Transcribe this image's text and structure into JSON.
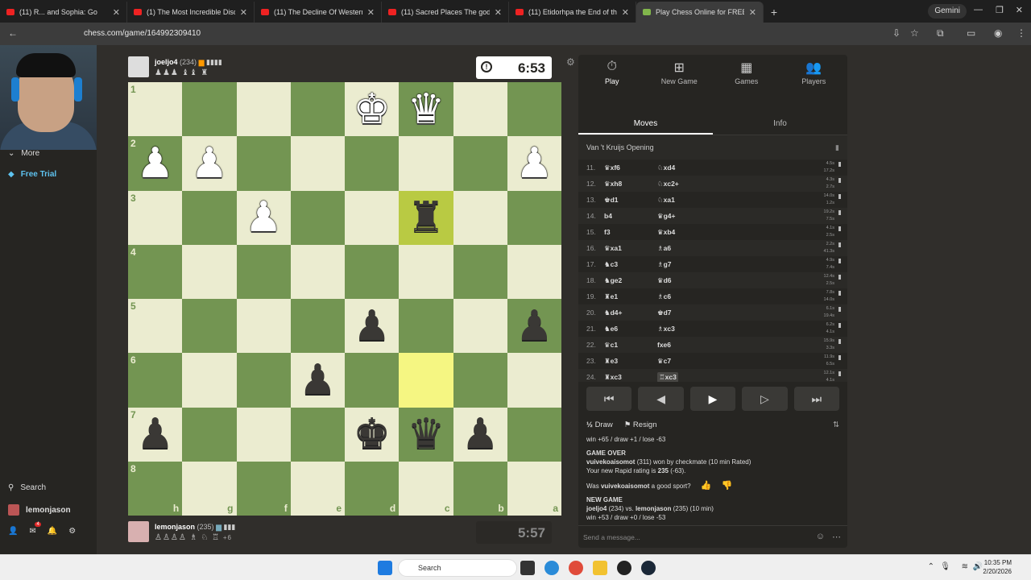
{
  "browser": {
    "tabs": [
      {
        "title": "(11) R... and Sophia: Go",
        "active": false
      },
      {
        "title": "(1) The Most Incredible Disco",
        "active": false
      },
      {
        "title": "(11) The Decline Of Western Ci",
        "active": false
      },
      {
        "title": "(11) Sacred Places The gods Sa",
        "active": false
      },
      {
        "title": "(11) Etidorhpa the End of the E",
        "active": false
      },
      {
        "title": "Play Chess Online for FREE",
        "active": true
      }
    ],
    "new_tab": "+",
    "gemini": "Gemini",
    "url": "chess.com/game/164992309410"
  },
  "sidebar": {
    "more": "More",
    "free_trial": "Free Trial",
    "search": "Search",
    "username": "lemonjason",
    "notif_count": "4"
  },
  "top_player": {
    "name": "joeljo4",
    "rating": "(234)",
    "captured": "♟♟♟ ♝♝ ♜",
    "clock": "6:53"
  },
  "bottom_player": {
    "name": "lemonjason",
    "rating": "(235)",
    "captured": "♙♙♙♙ ♗ ♘ ♖",
    "advantage": "+6",
    "clock": "5:57"
  },
  "board": {
    "ranks": [
      "1",
      "2",
      "3",
      "4",
      "5",
      "6",
      "7",
      "8"
    ],
    "files": [
      "h",
      "g",
      "f",
      "e",
      "d",
      "c",
      "b",
      "a"
    ],
    "squares": [
      [
        "",
        "",
        "",
        "",
        "wK",
        "wQ",
        "",
        ""
      ],
      [
        "wP",
        "wP",
        "",
        "",
        "",
        "",
        "",
        "wP"
      ],
      [
        "",
        "",
        "wP",
        "",
        "",
        "bR",
        "",
        ""
      ],
      [
        "",
        "",
        "",
        "",
        "",
        "",
        "",
        ""
      ],
      [
        "",
        "",
        "",
        "",
        "bP",
        "",
        "",
        "bP"
      ],
      [
        "",
        "",
        "",
        "bP",
        "",
        "",
        "",
        ""
      ],
      [
        "bP",
        "",
        "",
        "",
        "bK",
        "bQ",
        "bP",
        ""
      ],
      [
        "",
        "",
        "",
        "",
        "",
        "",
        "",
        ""
      ]
    ],
    "highlight": [
      [
        2,
        5
      ],
      [
        5,
        5
      ]
    ]
  },
  "panel": {
    "nav": [
      {
        "label": "Play",
        "icon": "stopwatch-icon",
        "glyph": "⏱",
        "active": true
      },
      {
        "label": "New Game",
        "icon": "plus-square-icon",
        "glyph": "⊞",
        "active": false
      },
      {
        "label": "Games",
        "icon": "grid-icon",
        "glyph": "▦",
        "active": false
      },
      {
        "label": "Players",
        "icon": "players-icon",
        "glyph": "👥",
        "active": false
      }
    ],
    "subtabs": [
      "Moves",
      "Info"
    ],
    "opening": "Van 't Kruijs Opening",
    "moves": [
      {
        "n": "11.",
        "w": "♛xf6",
        "b": "♘xd4",
        "tw": "4.5s",
        "tb": "17.2s"
      },
      {
        "n": "12.",
        "w": "♛xh8",
        "b": "♘xc2+",
        "tw": "4.3s",
        "tb": "2.7s"
      },
      {
        "n": "13.",
        "w": "♚d1",
        "b": "♘xa1",
        "tw": "14.0s",
        "tb": "1.2s"
      },
      {
        "n": "14.",
        "w": "b4",
        "b": "♛g4+",
        "tw": "19.2s",
        "tb": "7.5s"
      },
      {
        "n": "15.",
        "w": "f3",
        "b": "♛xb4",
        "tw": "4.1s",
        "tb": "2.5s"
      },
      {
        "n": "16.",
        "w": "♛xa1",
        "b": "♗a6",
        "tw": "2.2s",
        "tb": "41.3s"
      },
      {
        "n": "17.",
        "w": "♞c3",
        "b": "♗g7",
        "tw": "4.9s",
        "tb": "7.4s"
      },
      {
        "n": "18.",
        "w": "♞ge2",
        "b": "♛d6",
        "tw": "12.4s",
        "tb": "2.5s"
      },
      {
        "n": "19.",
        "w": "♜e1",
        "b": "♗c6",
        "tw": "7.8s",
        "tb": "14.0s"
      },
      {
        "n": "20.",
        "w": "♞d4+",
        "b": "♚d7",
        "tw": "6.1s",
        "tb": "19.4s"
      },
      {
        "n": "21.",
        "w": "♞e6",
        "b": "♗xc3",
        "tw": "6.2s",
        "tb": "4.1s"
      },
      {
        "n": "22.",
        "w": "♛c1",
        "b": "fxe6",
        "tw": "15.9s",
        "tb": "3.3s"
      },
      {
        "n": "23.",
        "w": "♜e3",
        "b": "♛c7",
        "tw": "11.9s",
        "tb": "6.5s"
      },
      {
        "n": "24.",
        "w": "♜xc3",
        "b": "♖xc3",
        "tw": "12.1s",
        "tb": "4.1s"
      }
    ],
    "controls": [
      "⏮",
      "◀",
      "▶",
      "▷",
      "⏭"
    ],
    "draw": "Draw",
    "resign": "Resign",
    "log": {
      "prev": "win +65 / draw +1 / lose -63",
      "game_over": "GAME OVER",
      "winner": "vuivekoaisomot",
      "result": "(311) won by checkmate (10 min Rated)",
      "rating_line": "Your new Rapid rating is",
      "new_rating": "235",
      "rating_delta": "(-63).",
      "sport_q1": "Was",
      "sport_name": "vuivekoaisomot",
      "sport_q2": "a good sport?",
      "new_game": "NEW GAME",
      "ng_p1": "joeljo4",
      "ng_mid": "(234) vs.",
      "ng_p2": "lemonjason",
      "ng_tail": "(235) (10 min)",
      "ng_stats": "win +53 / draw +0 / lose -53"
    },
    "message_placeholder": "Send a message..."
  },
  "taskbar": {
    "search": "Search",
    "time": "10:35 PM",
    "date": "2/20/2026"
  }
}
